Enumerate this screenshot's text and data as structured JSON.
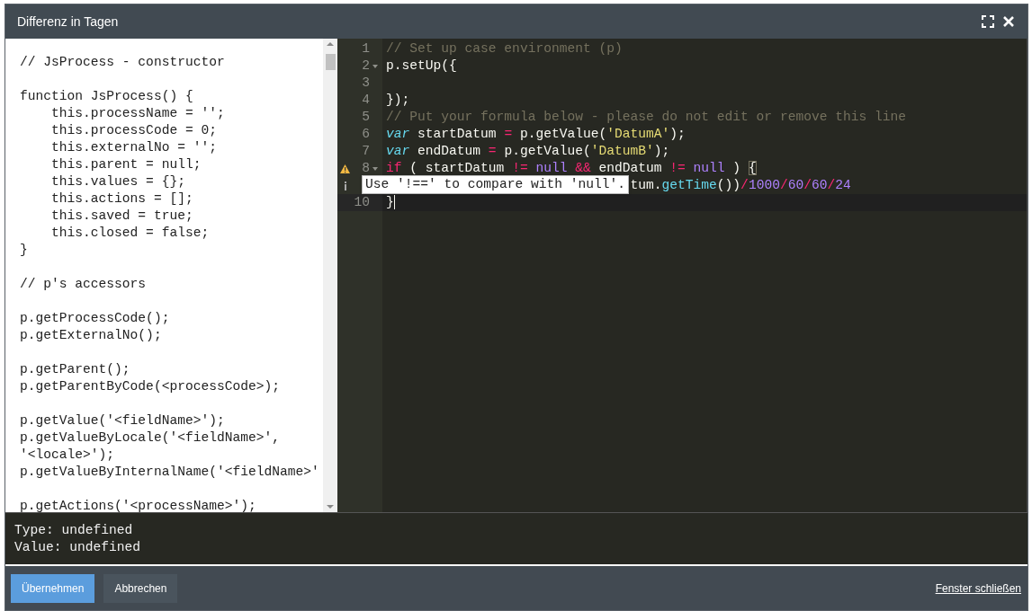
{
  "window": {
    "title": "Differenz in Tagen"
  },
  "reference_panel": {
    "blocks": [
      [
        "// JsProcess - constructor"
      ],
      [
        "function JsProcess() {",
        "    this.processName = '';",
        "    this.processCode = 0;",
        "    this.externalNo = '';",
        "    this.parent = null;",
        "    this.values = {};",
        "    this.actions = [];",
        "    this.saved = true;",
        "    this.closed = false;",
        "}"
      ],
      [
        "// p's accessors"
      ],
      [
        "p.getProcessCode();",
        "p.getExternalNo();"
      ],
      [
        "p.getParent();",
        "p.getParentByCode(<processCode>);"
      ],
      [
        "p.getValue('<fieldName>');",
        "p.getValueByLocale('<fieldName>',",
        "'<locale>');",
        "p.getValueByInternalName('<fieldName>'"
      ],
      [
        "p.getActions('<processName>');"
      ]
    ]
  },
  "editor": {
    "lines": [
      {
        "number": "1",
        "fold": false,
        "active": false,
        "tokens": [
          {
            "text": "// Set up case environment (p)",
            "kind": "comment"
          }
        ]
      },
      {
        "number": "2",
        "fold": true,
        "active": false,
        "tokens": [
          {
            "text": "p.setUp({",
            "kind": "plain"
          }
        ]
      },
      {
        "number": "3",
        "fold": false,
        "active": false
      },
      {
        "number": "4",
        "fold": false,
        "active": false,
        "tokens": [
          {
            "text": "});",
            "kind": "plain"
          }
        ]
      },
      {
        "number": "5",
        "fold": false,
        "active": false,
        "tokens": [
          {
            "text": "// Put your formula below - please do not edit or remove this line",
            "kind": "comment"
          }
        ]
      },
      {
        "number": "6",
        "fold": false,
        "active": false,
        "tokens": [
          {
            "text": "var",
            "kind": "storage"
          },
          {
            "text": " startDatum ",
            "kind": "plain"
          },
          {
            "text": "=",
            "kind": "operator"
          },
          {
            "text": " p.getValue(",
            "kind": "plain"
          },
          {
            "text": "'DatumA'",
            "kind": "string"
          },
          {
            "text": ");",
            "kind": "plain"
          }
        ]
      },
      {
        "number": "7",
        "fold": false,
        "active": false,
        "tokens": [
          {
            "text": "var",
            "kind": "storage"
          },
          {
            "text": " endDatum ",
            "kind": "plain"
          },
          {
            "text": "=",
            "kind": "operator"
          },
          {
            "text": " p.getValue(",
            "kind": "plain"
          },
          {
            "text": "'DatumB'",
            "kind": "string"
          },
          {
            "text": ");",
            "kind": "plain"
          }
        ]
      },
      {
        "number": "8",
        "fold": true,
        "active": false,
        "warning": true,
        "tokens": [
          {
            "text": "if",
            "kind": "operator"
          },
          {
            "text": " ( startDatum ",
            "kind": "plain"
          },
          {
            "text": "!=",
            "kind": "operator"
          },
          {
            "text": " null",
            "kind": "constant"
          },
          {
            "text": " &&",
            "kind": "operator"
          },
          {
            "text": " endDatum ",
            "kind": "plain"
          },
          {
            "text": "!=",
            "kind": "operator"
          },
          {
            "text": " null",
            "kind": "constant"
          },
          {
            "text": " ) ",
            "kind": "plain"
          },
          {
            "text": "{",
            "kind": "bracket_match"
          }
        ]
      },
      {
        "kind": "obscured",
        "fold": false,
        "active": false,
        "info": true,
        "tokens": [
          {
            "text": "tum.",
            "kind": "plain"
          },
          {
            "text": "getTime",
            "kind": "function"
          },
          {
            "text": "())",
            "kind": "plain"
          },
          {
            "text": "/",
            "kind": "operator"
          },
          {
            "text": "1000",
            "kind": "constant"
          },
          {
            "text": "/",
            "kind": "operator"
          },
          {
            "text": "60",
            "kind": "constant"
          },
          {
            "text": "/",
            "kind": "operator"
          },
          {
            "text": "60",
            "kind": "constant"
          },
          {
            "text": "/",
            "kind": "operator"
          },
          {
            "text": "24",
            "kind": "constant"
          }
        ]
      },
      {
        "number": "10",
        "fold": false,
        "active": true,
        "tokens": [
          {
            "text": "}",
            "kind": "plain"
          }
        ]
      }
    ],
    "tooltip": "Use '!==' to compare with 'null'."
  },
  "output": [
    "Type: undefined",
    "Value: undefined"
  ],
  "footer": {
    "buttons": [
      {
        "label": "Übernehmen",
        "kind": "primary"
      },
      {
        "label": "Abbrechen",
        "kind": "secondary"
      }
    ],
    "link": "Fenster schließen"
  }
}
